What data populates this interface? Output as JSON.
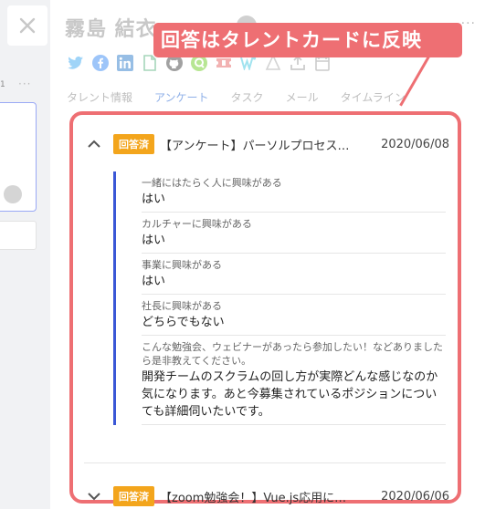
{
  "person": {
    "name": "霧島 結衣"
  },
  "background": {
    "list_number": "1"
  },
  "social_icons": [
    "twitter-icon",
    "facebook-icon",
    "linkedin-icon",
    "document-icon",
    "github-icon",
    "qiita-icon",
    "ticket-icon",
    "wantedly-icon",
    "atcoder-icon",
    "upload-icon",
    "calendar-icon"
  ],
  "tabs": [
    {
      "label": "タレント情報",
      "active": false
    },
    {
      "label": "アンケート",
      "active": true
    },
    {
      "label": "タスク",
      "active": false
    },
    {
      "label": "メール",
      "active": false
    },
    {
      "label": "タイムライン",
      "active": false
    }
  ],
  "callout": {
    "text": "回答はタレントカードに反映"
  },
  "surveys": [
    {
      "status": "回答済",
      "title": "【アンケート】パーソルプロセス…",
      "date": "2020/06/08",
      "expanded": true,
      "answers": [
        {
          "question": "一緒にはたらく人に興味がある",
          "answer": "はい"
        },
        {
          "question": "カルチャーに興味がある",
          "answer": "はい"
        },
        {
          "question": "事業に興味がある",
          "answer": "はい"
        },
        {
          "question": "社長に興味がある",
          "answer": "どちらでもない"
        },
        {
          "question": "こんな勉強会、ウェビナーがあったら参加したい！などありましたら是非教えてください。",
          "answer": "開発チームのスクラムの回し方が実際どんな感じなのか気になります。あと今募集されているポジションについても詳細伺いたいです。"
        }
      ]
    },
    {
      "status": "回答済",
      "title": "【zoom勉強会！】Vue.js応用に…",
      "date": "2020/06/06",
      "expanded": false
    }
  ],
  "colors": {
    "accent_red": "#ee6f73",
    "badge_orange": "#f3a51c",
    "answer_bar_blue": "#3a57d6",
    "active_tab": "#8fb0e8"
  }
}
